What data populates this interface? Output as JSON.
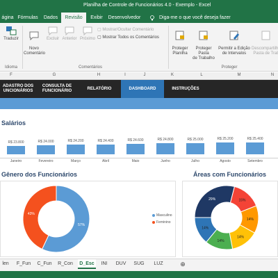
{
  "window": {
    "title": "Planilha de Controle de Funcionários 4.0 - Exemplo  -  Excel"
  },
  "ribbon_tabs": [
    {
      "label": "ágina"
    },
    {
      "label": "Fórmulas"
    },
    {
      "label": "Dados"
    },
    {
      "label": "Revisão"
    },
    {
      "label": "Exibir"
    },
    {
      "label": "Desenvolvedor"
    }
  ],
  "tell_me": "Diga-me o que você deseja fazer",
  "ribbon": {
    "translate": "Traduzir",
    "new_comment": "Novo\nComentário",
    "delete": "Excluir",
    "previous": "Anterior",
    "next": "Próximo",
    "show_hide": "Mostrar/Ocultar Comentário",
    "show_all": "Mostrar Todos os Comentários",
    "protect_sheet": "Proteger\nPlanilha",
    "protect_workbook": "Proteger Pasta\nde Trabalho",
    "allow_edit": "Permitir a Edição\nde Intervalos",
    "unshare": "Descompartilhar\nPasta de Trab",
    "group_idioma": "Idioma",
    "group_comments": "Comentários",
    "group_protect": "Proteger"
  },
  "columns": [
    "F",
    "G",
    "H",
    "I",
    "J",
    "K",
    "L",
    "M",
    "N"
  ],
  "nav": [
    {
      "label": "ADASTRO DOS\nUNCIONÁRIOS"
    },
    {
      "label": "CONSULTA DE\nFUNCIONÁRIO"
    },
    {
      "label": "RELATÓRIO"
    },
    {
      "label": "DASHBOARD"
    },
    {
      "label": "INSTRUÇÕES"
    }
  ],
  "salary_title": "Salários",
  "gender_title": "Gênero dos Funcionários",
  "areas_title": "Áreas com Funcionários",
  "chart_data": [
    {
      "type": "bar",
      "title": "Salários",
      "categories": [
        "Janeiro",
        "Fevereiro",
        "Março",
        "Abril",
        "Maio",
        "Junho",
        "Julho",
        "Agosto",
        "Setembro"
      ],
      "values": [
        23800,
        24000,
        24200,
        24400,
        24600,
        24800,
        25000,
        25200,
        25400
      ],
      "value_labels": [
        "R$ 23.800",
        "R$ 24.000",
        "R$ 24.200",
        "R$ 24.400",
        "R$ 24.600",
        "R$ 24.800",
        "R$ 25.000",
        "R$ 25.200",
        "R$ 25.400"
      ],
      "color": "#5b9bd5"
    },
    {
      "type": "pie",
      "title": "Gênero dos Funcionários",
      "labels": [
        "Masculino",
        "Feminino"
      ],
      "values": [
        57,
        43
      ],
      "value_labels": [
        "57%",
        "43%"
      ],
      "colors": [
        "#5b9bd5",
        "#f4511e"
      ],
      "legend": "right"
    },
    {
      "type": "pie",
      "title": "Áreas com Funcionários",
      "values": [
        29,
        15,
        14,
        14,
        14,
        14
      ],
      "value_labels": [
        "29%",
        "15%",
        "14%",
        "14%",
        "14%",
        "14%"
      ],
      "colors": [
        "#1f3864",
        "#f44336",
        "#ff9800",
        "#ffc107",
        "#4caf50",
        "#2e75b6"
      ]
    }
  ],
  "sheet_tabs": [
    {
      "label": "len"
    },
    {
      "label": "F_Fun"
    },
    {
      "label": "C_Fun"
    },
    {
      "label": "R_Con"
    },
    {
      "label": "D_Esc"
    },
    {
      "label": "INI"
    },
    {
      "label": "DUV"
    },
    {
      "label": "SUG"
    },
    {
      "label": "LUZ"
    }
  ]
}
